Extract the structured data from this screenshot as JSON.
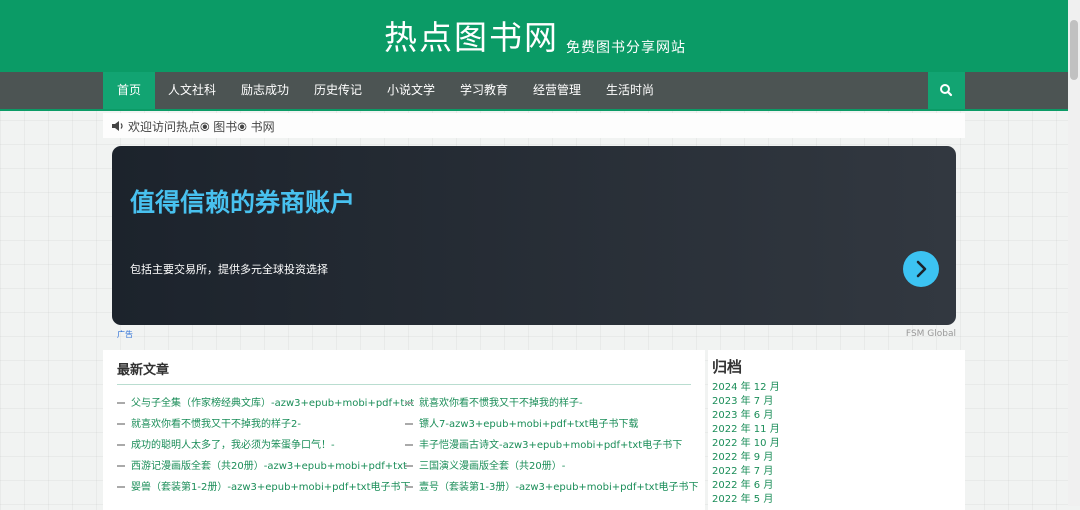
{
  "header": {
    "logo": "热点图书网",
    "slogan": "免费图书分享网站"
  },
  "nav": {
    "items": [
      {
        "label": "首页"
      },
      {
        "label": "人文社科"
      },
      {
        "label": "励志成功"
      },
      {
        "label": "历史传记"
      },
      {
        "label": "小说文学"
      },
      {
        "label": "学习教育"
      },
      {
        "label": "经营管理"
      },
      {
        "label": "生活时尚"
      }
    ]
  },
  "notice": {
    "text": "欢迎访问热点🞊 图书🞊 书网"
  },
  "ad": {
    "title": "值得信赖的券商账户",
    "subtitle": "包括主要交易所，提供多元全球投资选择",
    "mark": "广告",
    "brand": "FSM Global"
  },
  "latest": {
    "title": "最新文章",
    "left": [
      "父与子全集（作家榜经典文库）-azw3+epub+mobi+pdf+txt",
      "就喜欢你看不惯我又干不掉我的样子2-",
      "成功的聪明人太多了，我必须为笨蛋争口气！-",
      "西游记漫画版全套（共20册）-azw3+epub+mobi+pdf+txt",
      "婴兽（套装第1-2册）-azw3+epub+mobi+pdf+txt电子书下"
    ],
    "right": [
      "就喜欢你看不惯我又干不掉我的样子-",
      "镖人7-azw3+epub+mobi+pdf+txt电子书下载",
      "丰子恺漫画古诗文-azw3+epub+mobi+pdf+txt电子书下",
      "三国演义漫画版全套（共20册）-",
      "壹号（套装第1-3册）-azw3+epub+mobi+pdf+txt电子书下"
    ]
  },
  "archive": {
    "title": "归档",
    "items": [
      "2024 年 12 月",
      "2023 年 7 月",
      "2023 年 6 月",
      "2022 年 11 月",
      "2022 年 10 月",
      "2022 年 9 月",
      "2022 年 7 月",
      "2022 年 6 月",
      "2022 年 5 月"
    ]
  }
}
